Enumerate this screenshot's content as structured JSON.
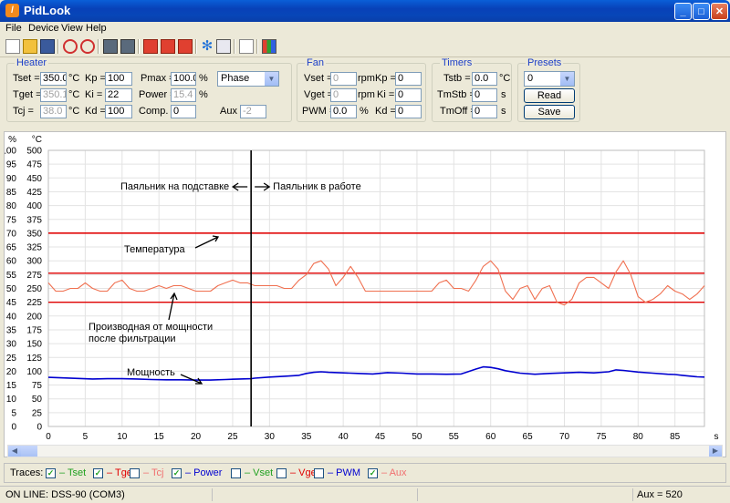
{
  "window": {
    "title": "PidLook",
    "app_icon": "pidlook-icon"
  },
  "menu": [
    "File",
    "Device",
    "View",
    "Help"
  ],
  "toolbar": {
    "icons": [
      "new-file-icon",
      "open-file-icon",
      "save-icon",
      "power-on-icon",
      "power-off-icon",
      "chart-settings-icon",
      "chart-export-icon",
      "play-icon",
      "pause-icon",
      "stop-icon",
      "snowflake-icon",
      "grid-icon",
      "document-icon",
      "palette-icon"
    ]
  },
  "heater": {
    "title": "Heater",
    "tset_label": "Tset =",
    "tset_value": "350.0",
    "tset_unit": "°C",
    "tget_label": "Tget =",
    "tget_value": "350.1",
    "tget_unit": "°C",
    "tcj_label": "Tcj =",
    "tcj_value": "38.0",
    "tcj_unit": "°C",
    "kp_label": "Kp =",
    "kp_value": "100",
    "ki_label": "Ki =",
    "ki_value": "22",
    "kd_label": "Kd =",
    "kd_value": "100",
    "pmax_label": "Pmax =",
    "pmax_value": "100.0",
    "pmax_unit": "%",
    "power_label": "Power =",
    "power_value": "15.4",
    "power_unit": "%",
    "comp_label": "Comp. =",
    "comp_value": "0",
    "mode_value": "Phase",
    "aux_label": "Aux =",
    "aux_value": "-2"
  },
  "fan": {
    "title": "Fan",
    "vset_label": "Vset =",
    "vset_value": "0",
    "vset_unit": "rpm",
    "vget_label": "Vget =",
    "vget_value": "0",
    "vget_unit": "rpm",
    "pwm_label": "PWM =",
    "pwm_value": "0.0",
    "pwm_unit": "%",
    "kp_label": "Kp =",
    "kp_value": "0",
    "ki_label": "Ki =",
    "ki_value": "0",
    "kd_label": "Kd =",
    "kd_value": "0"
  },
  "timers": {
    "title": "Timers",
    "tstb_label": "Tstb =",
    "tstb_value": "0.0",
    "tstb_unit": "°C",
    "tmstb_label": "TmStb =",
    "tmstb_value": "0",
    "tmstb_unit": "s",
    "tmoff_label": "TmOff =",
    "tmoff_value": "0",
    "tmoff_unit": "s"
  },
  "presets": {
    "title": "Presets",
    "selected": "0",
    "read_label": "Read",
    "save_label": "Save"
  },
  "chart_data": {
    "type": "line",
    "axes": {
      "y_left_unit": "%",
      "y_right_unit": "°C",
      "y_left_ticks": [
        "100",
        "95",
        "90",
        "85",
        "80",
        "75",
        "70",
        "65",
        "60",
        "55",
        "50",
        "45",
        "40",
        "35",
        "30",
        "25",
        "20",
        "15",
        "10",
        "5",
        "0"
      ],
      "y_right_ticks": [
        "500",
        "475",
        "450",
        "425",
        "400",
        "375",
        "350",
        "325",
        "300",
        "275",
        "250",
        "225",
        "200",
        "175",
        "150",
        "125",
        "100",
        "75",
        "50",
        "25",
        "0"
      ],
      "x_ticks": [
        "0",
        "5",
        "10",
        "15",
        "20",
        "25",
        "30",
        "35",
        "40",
        "45",
        "50",
        "55",
        "60",
        "65",
        "70",
        "75",
        "80",
        "85"
      ],
      "x_unit": "s",
      "xlim": [
        0,
        89
      ],
      "ylim_percent": [
        0,
        100
      ],
      "ylim_celsius": [
        0,
        500
      ],
      "grid": true
    },
    "series": [
      {
        "name": "Tset",
        "color": "#e00000",
        "unit": "°C",
        "x": [
          0,
          89
        ],
        "y": [
          350,
          350
        ]
      },
      {
        "name": "Tget",
        "color": "#e00000",
        "unit": "°C",
        "x": [
          0,
          89
        ],
        "y": [
          350.2,
          350.2
        ]
      },
      {
        "name": "Power",
        "color": "#0000d0",
        "unit": "%",
        "x": [
          0,
          2,
          4,
          6,
          8,
          10,
          12,
          14,
          16,
          18,
          20,
          22,
          24,
          26,
          27.5,
          28,
          30,
          32,
          34,
          35,
          36,
          37,
          38,
          40,
          42,
          44,
          46,
          48,
          50,
          52,
          54,
          56,
          58,
          59,
          60,
          61,
          62,
          64,
          66,
          68,
          70,
          72,
          74,
          76,
          77,
          78,
          80,
          82,
          84,
          85,
          86,
          88,
          89
        ],
        "y": [
          17.8,
          17.6,
          17.4,
          17.2,
          17.3,
          17.3,
          17.2,
          17.0,
          16.9,
          16.9,
          16.8,
          16.8,
          17.0,
          17.2,
          17.3,
          17.5,
          17.9,
          18.2,
          18.5,
          19.2,
          19.6,
          19.8,
          19.6,
          19.4,
          19.2,
          19.0,
          19.5,
          19.3,
          19.0,
          19.0,
          18.9,
          19.0,
          20.8,
          21.6,
          21.4,
          20.9,
          20.2,
          19.3,
          18.9,
          19.2,
          19.4,
          19.6,
          19.4,
          19.8,
          20.5,
          20.3,
          19.7,
          19.3,
          18.9,
          18.8,
          18.5,
          18.0,
          17.9
        ]
      },
      {
        "name": "Aux",
        "color": "#f07050",
        "unit": "%",
        "x": [
          0,
          1,
          2,
          3,
          4,
          5,
          6,
          7,
          8,
          9,
          10,
          11,
          12,
          13,
          14,
          15,
          16,
          17,
          18,
          19,
          20,
          21,
          22,
          23,
          24,
          25,
          26,
          27,
          28,
          29,
          30,
          31,
          32,
          33,
          34,
          35,
          36,
          37,
          38,
          39,
          40,
          41,
          42,
          43,
          44,
          45,
          46,
          47,
          48,
          49,
          50,
          51,
          52,
          53,
          54,
          55,
          56,
          57,
          58,
          59,
          60,
          61,
          62,
          63,
          64,
          65,
          66,
          67,
          68,
          69,
          70,
          71,
          72,
          73,
          74,
          75,
          76,
          77,
          78,
          79,
          80,
          81,
          82,
          83,
          84,
          85,
          86,
          87,
          88,
          89
        ],
        "y": [
          52,
          49,
          49,
          50,
          50,
          52,
          50,
          49,
          49,
          52,
          53,
          50,
          49,
          49,
          50,
          51,
          50,
          51,
          51,
          50,
          49,
          49,
          49,
          51,
          52,
          53,
          52,
          52,
          51,
          51,
          51,
          51,
          50,
          50,
          53,
          55,
          59,
          60,
          57,
          51,
          54,
          58,
          54,
          49,
          49,
          49,
          49,
          49,
          49,
          49,
          49,
          49,
          49,
          52,
          53,
          50,
          50,
          49,
          53,
          58,
          60,
          57,
          49,
          46,
          50,
          51,
          46,
          50,
          51,
          45,
          44,
          46,
          52,
          54,
          54,
          52,
          50,
          56,
          60,
          55,
          47,
          45,
          46,
          48,
          51,
          49,
          48,
          46,
          48,
          51
        ]
      }
    ],
    "reference_lines": [
      {
        "axis": "percent",
        "value": 55.5,
        "color": "#e00000"
      },
      {
        "axis": "percent",
        "value": 45,
        "color": "#e00000"
      }
    ],
    "markers": [
      {
        "x": 27.5,
        "color": "#000000"
      }
    ],
    "annotations": {
      "stand": "Паяльник на подставке",
      "work": "Паяльник в работе",
      "temperature": "Температура",
      "derivative_line1": "Производная от мощности",
      "derivative_line2": "после фильтрации",
      "power": "Мощность"
    }
  },
  "traces": {
    "label": "Traces:",
    "items": [
      {
        "name": "Tset",
        "checked": true,
        "color": "#21a121"
      },
      {
        "name": "Tget",
        "checked": true,
        "color": "#e00000"
      },
      {
        "name": "Tcj",
        "checked": false,
        "color": "#f07070"
      },
      {
        "name": "Power",
        "checked": true,
        "color": "#0000d0"
      },
      {
        "name": "Vset",
        "checked": false,
        "color": "#21a121"
      },
      {
        "name": "Vget",
        "checked": false,
        "color": "#e00000"
      },
      {
        "name": "PWM",
        "checked": false,
        "color": "#0000d0"
      },
      {
        "name": "Aux",
        "checked": true,
        "color": "#f07070"
      }
    ]
  },
  "status": {
    "connection": "ON LINE: DSS-90 (COM3)",
    "aux": "Aux = 520"
  }
}
